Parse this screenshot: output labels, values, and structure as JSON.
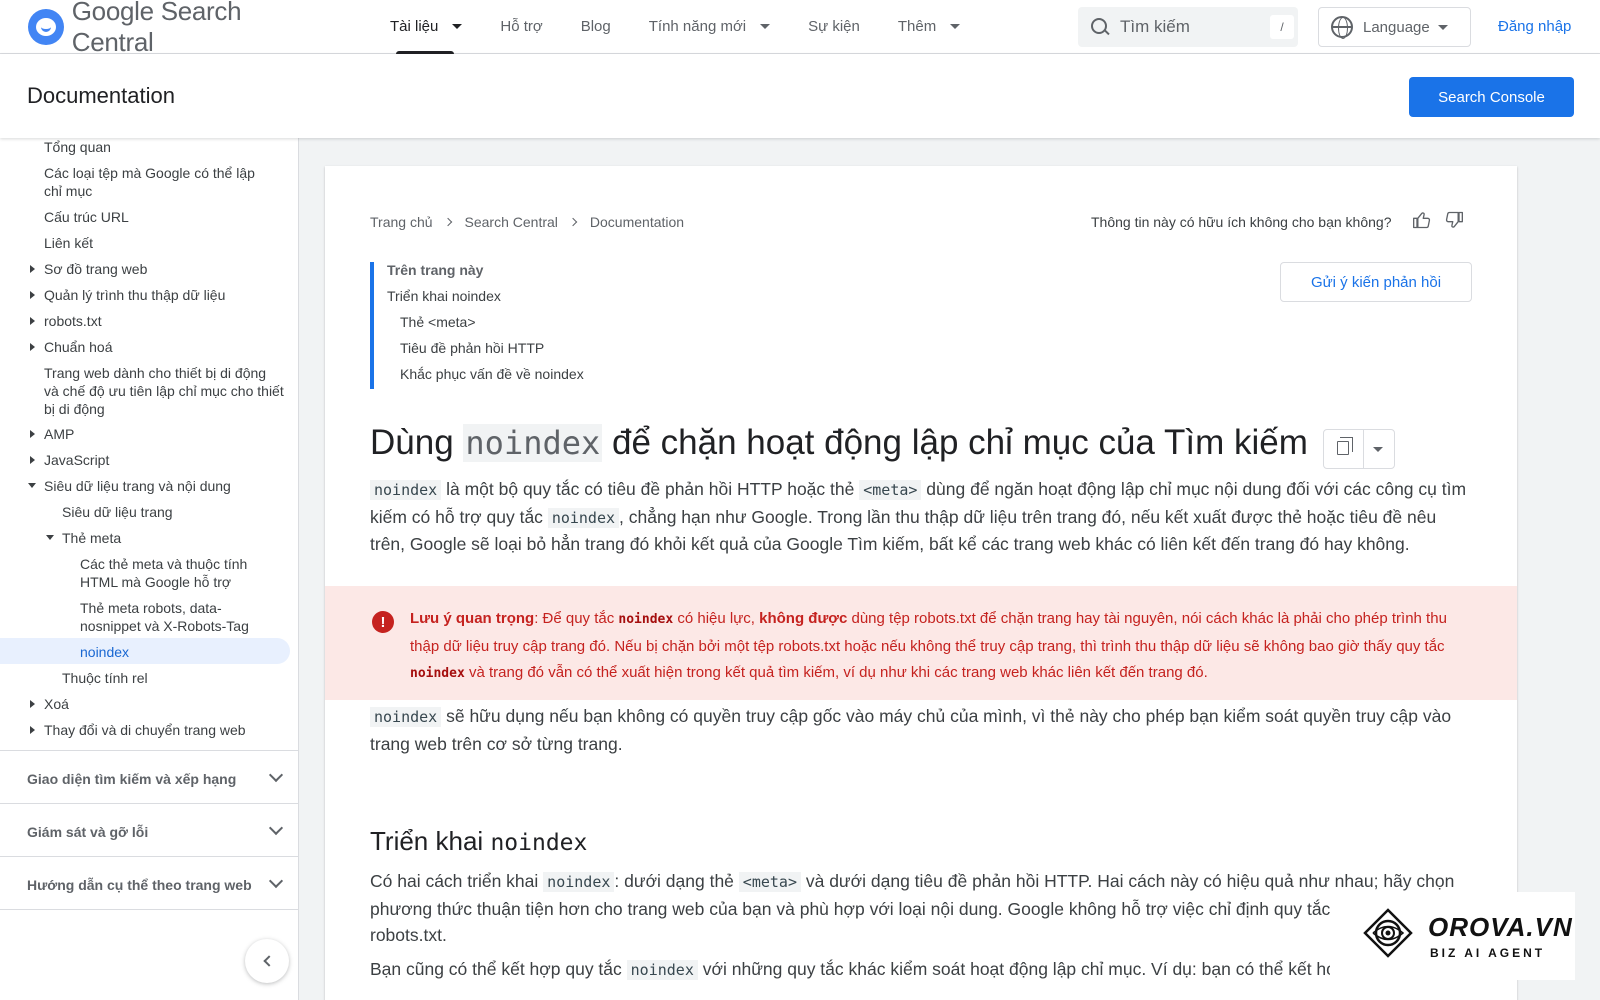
{
  "header": {
    "logo_text": "Google Search Central",
    "nav": [
      {
        "label": "Tài liệu"
      },
      {
        "label": "Hỗ trợ"
      },
      {
        "label": "Blog"
      },
      {
        "label": "Tính năng mới"
      },
      {
        "label": "Sự kiện"
      },
      {
        "label": "Thêm"
      }
    ],
    "search_placeholder": "Tìm kiếm",
    "search_shortcut": "/",
    "language_label": "Language",
    "signin_label": "Đăng nhập"
  },
  "subheader": {
    "title": "Documentation",
    "console_button": "Search Console"
  },
  "sidebar": {
    "items": [
      {
        "label": "Tổng quan"
      },
      {
        "label": "Các loại tệp mà Google có thể lập chỉ mục"
      },
      {
        "label": "Cấu trúc URL"
      },
      {
        "label": "Liên kết"
      },
      {
        "label": "Sơ đồ trang web"
      },
      {
        "label": "Quản lý trình thu thập dữ liệu"
      },
      {
        "label": "robots.txt"
      },
      {
        "label": "Chuẩn hoá"
      },
      {
        "label": "Trang web dành cho thiết bị di động và chế độ ưu tiên lập chỉ mục cho thiết bị di động"
      },
      {
        "label": "AMP"
      },
      {
        "label": "JavaScript"
      },
      {
        "label": "Siêu dữ liệu trang và nội dung"
      },
      {
        "label": "Siêu dữ liệu trang"
      },
      {
        "label": "Thẻ meta"
      },
      {
        "label": "Các thẻ meta và thuộc tính HTML mà Google hỗ trợ"
      },
      {
        "label": "Thẻ meta robots, data-nosnippet và X-Robots-Tag"
      },
      {
        "label": "noindex"
      },
      {
        "label": "Thuộc tính rel"
      },
      {
        "label": "Xoá"
      },
      {
        "label": "Thay đổi và di chuyển trang web"
      }
    ],
    "sections": [
      {
        "label": "Giao diện tìm kiếm và xếp hạng"
      },
      {
        "label": "Giám sát và gỡ lỗi"
      },
      {
        "label": "Hướng dẫn cụ thể theo trang web"
      }
    ]
  },
  "content": {
    "breadcrumb": [
      "Trang chủ",
      "Search Central",
      "Documentation"
    ],
    "helpful_question": "Thông tin này có hữu ích không cho bạn không?",
    "feedback_button": "Gửi ý kiến phản hồi",
    "toc": {
      "title": "Trên trang này",
      "items": [
        "Triển khai noindex",
        "Thẻ <meta>",
        "Tiêu đề phản hồi HTTP",
        "Khắc phục vấn đề về noindex"
      ]
    },
    "h1_before": "Dùng",
    "h1_code": "noindex",
    "h1_after": "để chặn hoạt động lập chỉ mục của Tìm kiếm",
    "p1": {
      "code1": "noindex",
      "t1": "là một bộ quy tắc có tiêu đề phản hồi HTTP hoặc thẻ",
      "code2": "<meta>",
      "t2": "dùng để ngăn hoạt động lập chỉ mục nội dung đối với các công cụ tìm kiếm có hỗ trợ quy tắc",
      "code3": "noindex",
      "t3": ", chẳng hạn như Google. Trong lần thu thập dữ liệu trên trang đó, nếu kết xuất được thẻ hoặc tiêu đề nêu trên, Google sẽ loại bỏ hẳn trang đó khỏi kết quả của Google Tìm kiếm, bất kể các trang web khác có liên kết đến trang đó hay không."
    },
    "warning": {
      "label": "Lưu ý quan trọng",
      "t1": ": Để quy tắc",
      "code1": "noindex",
      "t2": "có hiệu lực,",
      "bold": "không được",
      "t3": "dùng tệp robots.txt để chặn trang hay tài nguyên, nói cách khác là phải cho phép trình thu thập dữ liệu truy cập trang đó. Nếu bị chặn bởi một tệp robots.txt hoặc nếu không thể truy cập trang, thì trình thu thập dữ liệu sẽ không bao giờ thấy quy tắc",
      "code2": "noindex",
      "t4": "và trang đó vẫn có thể xuất hiện trong kết quả tìm kiếm, ví dụ như khi các trang web khác liên kết đến trang đó."
    },
    "p2": {
      "code1": "noindex",
      "t1": "sẽ hữu dụng nếu bạn không có quyền truy cập gốc vào máy chủ của mình, vì thẻ này cho phép bạn kiểm soát quyền truy cập vào trang web trên cơ sở từng trang."
    },
    "h2_before": "Triển khai",
    "h2_code": "noindex",
    "p3": {
      "t1": "Có hai cách triển khai",
      "code1": "noindex",
      "t2": ": dưới dạng thẻ",
      "code2": "<meta>",
      "t3": "và dưới dạng tiêu đề phản hồi HTTP. Hai cách này có hiệu quả như nhau; hãy chọn phương thức thuận tiện hơn cho trang web của bạn và phù hợp với loại nội dung. Google không hỗ trợ việc chỉ định quy tắc noindex trong tệp robots.txt."
    },
    "p4": {
      "t1": "Bạn cũng có thể kết hợp quy tắc",
      "code1": "noindex",
      "t2": "với những quy tắc khác kiểm soát hoạt động lập chỉ mục. Ví dụ: bạn có thể kết hợp gợi ý"
    }
  },
  "watermark": {
    "title": "OROVA.VN",
    "subtitle": "BIZ AI AGENT"
  }
}
